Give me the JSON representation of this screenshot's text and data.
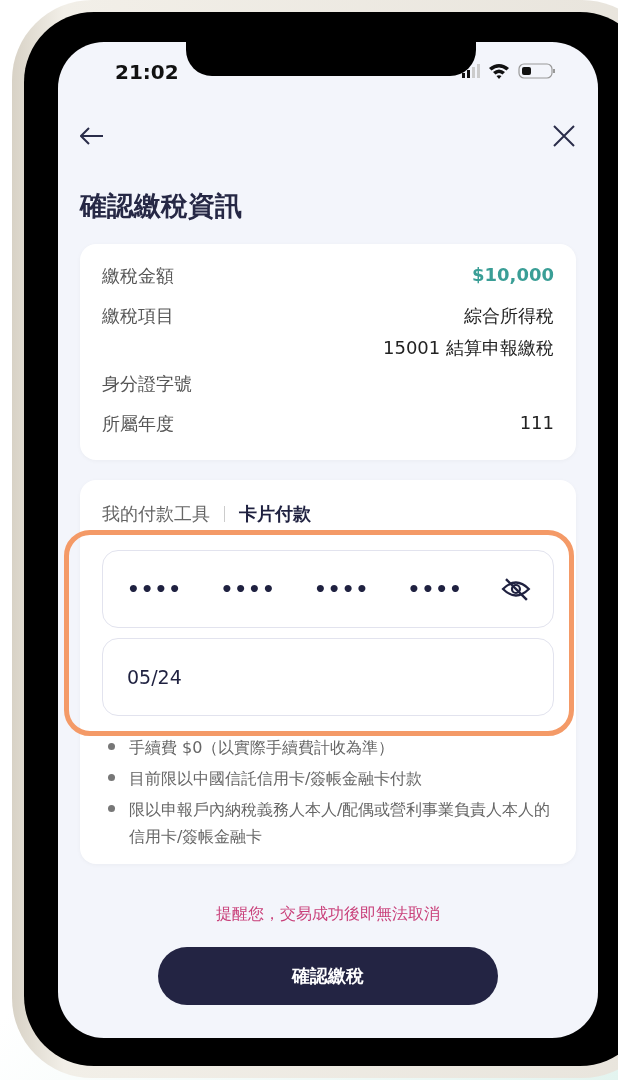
{
  "status_bar": {
    "time": "21:02"
  },
  "header": {
    "title": "確認繳稅資訊"
  },
  "summary": {
    "rows": [
      {
        "label": "繳稅金額",
        "values": [
          "$10,000"
        ],
        "kind": "amount"
      },
      {
        "label": "繳稅項目",
        "values": [
          "綜合所得稅",
          "15001 結算申報繳稅"
        ],
        "kind": "text"
      },
      {
        "label": "身分證字號",
        "kind": "text"
      },
      {
        "label": "所屬年度",
        "values": [
          "111"
        ],
        "kind": "text"
      }
    ]
  },
  "payment": {
    "tabs": [
      {
        "label": "我的付款工具",
        "selected": false
      },
      {
        "label": "卡片付款",
        "selected": true
      }
    ],
    "card_number": [
      "••••",
      "••••",
      "••••",
      "••••"
    ],
    "expiry": "05/24",
    "highlighted": true,
    "notes": [
      "手續費 $0（以實際手續費計收為準）",
      "目前限以中國信託信用卡/簽帳金融卡付款",
      "限以申報戶內納稅義務人本人/配偶或營利事業負責人本人的信用卡/簽帳金融卡"
    ]
  },
  "warning": "提醒您，交易成功後即無法取消",
  "confirm_button": "確認繳稅"
}
